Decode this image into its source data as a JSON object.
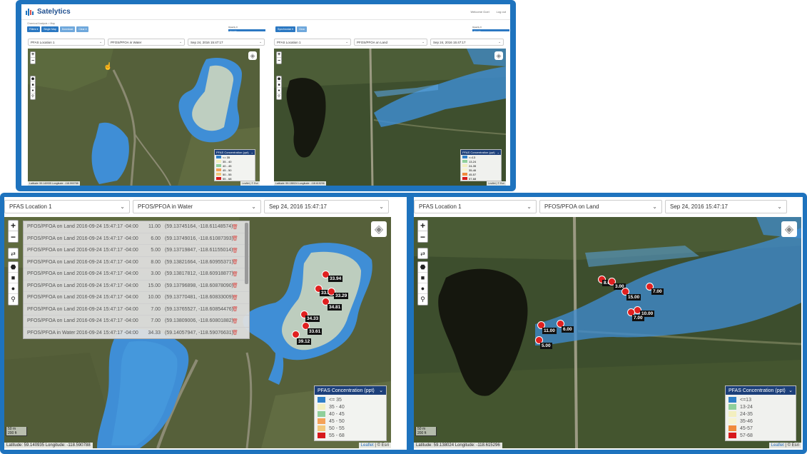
{
  "top": {
    "brand": "Satelytics",
    "header_right": [
      "Welcome Goel",
      "Log out"
    ],
    "breadcrumb": "Chemical Analysis  >  Map",
    "toolbar_left": [
      "Filters ▾",
      "Single Map",
      "Download",
      "Clear ▾"
    ],
    "toolbar_right": [
      "Synchronize ▾",
      "Clear"
    ],
    "opacity_label": "Opacity 0",
    "opacity_value": 0.6,
    "opacity_btn": "Opacity",
    "left_selects": [
      "PFAS Location 1",
      "PFOS/PFOA in Water",
      "Sep 24, 2016 15:47:17"
    ],
    "right_selects": [
      "PFAS Location 1",
      "PFOS/PFOA on Land",
      "Sep 24, 2016 15:47:17"
    ],
    "left_status": "Latitude: 59.140935  Longitude: -118.590788",
    "right_status": "Latitude: 59.138024  Longitude: -118.615296",
    "attribution": "Leaflet | © Esri"
  },
  "bottom": {
    "left_selects": [
      "PFAS Location 1",
      "PFOS/PFOA in Water",
      "Sep 24, 2016 15:47:17"
    ],
    "right_selects": [
      "PFAS Location 1",
      "PFOS/PFOA on Land",
      "Sep 24, 2016 15:47:17"
    ],
    "zoom_in": "+",
    "zoom_out": "−",
    "scale_m": "50 m",
    "scale_ft": "200 ft",
    "left_status": "Latitude: 59.140935  Longitude: -118.590788",
    "right_status": "Latitude: 59.138024  Longitude: -118.615296",
    "attribution_link": "Leaflet",
    "attribution_rest": " | © Esri",
    "table_rows": [
      {
        "type": "PFOS/PFOA on Land",
        "time": "2016-09-24 15:47:17 -04:00",
        "value": "11.00",
        "coords": "(59.13745164, -118.61148574)"
      },
      {
        "type": "PFOS/PFOA on Land",
        "time": "2016-09-24 15:47:17 -04:00",
        "value": "6.00",
        "coords": "(59.13749016, -118.61087393)"
      },
      {
        "type": "PFOS/PFOA on Land",
        "time": "2016-09-24 15:47:17 -04:00",
        "value": "5.00",
        "coords": "(59.13719847, -118.61155014)"
      },
      {
        "type": "PFOS/PFOA on Land",
        "time": "2016-09-24 15:47:17 -04:00",
        "value": "8.00",
        "coords": "(59.13821664, -118.60955371)"
      },
      {
        "type": "PFOS/PFOA on Land",
        "time": "2016-09-24 15:47:17 -04:00",
        "value": "3.00",
        "coords": "(59.13817812, -118.60918877)"
      },
      {
        "type": "PFOS/PFOA on Land",
        "time": "2016-09-24 15:47:17 -04:00",
        "value": "15.00",
        "coords": "(59.13796898, -118.60878090)"
      },
      {
        "type": "PFOS/PFOA on Land",
        "time": "2016-09-24 15:47:17 -04:00",
        "value": "10.00",
        "coords": "(59.13770481, -118.60833009)"
      },
      {
        "type": "PFOS/PFOA on Land",
        "time": "2016-09-24 15:47:17 -04:00",
        "value": "7.00",
        "coords": "(59.13765527, -118.60854476)"
      },
      {
        "type": "PFOS/PFOA on Land",
        "time": "2016-09-24 15:47:17 -04:00",
        "value": "7.00",
        "coords": "(59.13809006, -118.60801882)"
      },
      {
        "type": "PFOS/PFOA in Water",
        "time": "2016-09-24 15:47:17 -04:00",
        "value": "34.33",
        "coords": "(59.14057947, -118.59076631)"
      }
    ],
    "left_markers": [
      "33.94",
      "33.32",
      "33.29",
      "34.81",
      "34.33",
      "33.61",
      "39.12"
    ],
    "right_markers": [
      "8.00",
      "3.00",
      "15.00",
      "7.00",
      "10.00",
      "7.00",
      "11.00",
      "6.00",
      "5.00"
    ]
  },
  "legend_water": {
    "title": "PFAS Concentration (ppt)",
    "items": [
      {
        "label": "<= 35",
        "color": "#2f7fc8"
      },
      {
        "label": "35 - 40",
        "color": "#f3efbf"
      },
      {
        "label": "40 - 45",
        "color": "#8fcf9b"
      },
      {
        "label": "45 - 50",
        "color": "#f4a259"
      },
      {
        "label": "50 - 55",
        "color": "#f2c87c"
      },
      {
        "label": "55 - 68",
        "color": "#d7191c"
      }
    ]
  },
  "legend_land": {
    "title": "PFAS Concentration (ppt)",
    "items": [
      {
        "label": "<=13",
        "color": "#2f7fc8"
      },
      {
        "label": "13-24",
        "color": "#8fcf9b"
      },
      {
        "label": "24-35",
        "color": "#f3efbf"
      },
      {
        "label": "35-46",
        "color": "#f7f3d0"
      },
      {
        "label": "45-57",
        "color": "#f08a3c"
      },
      {
        "label": "57-68",
        "color": "#d7191c"
      }
    ]
  },
  "icons": [
    "layers-icon",
    "draw-polygon-icon",
    "draw-square-icon",
    "draw-circle-icon",
    "draw-marker-icon",
    "trash-icon",
    "chevron-down-icon",
    "hand-cursor-icon"
  ]
}
